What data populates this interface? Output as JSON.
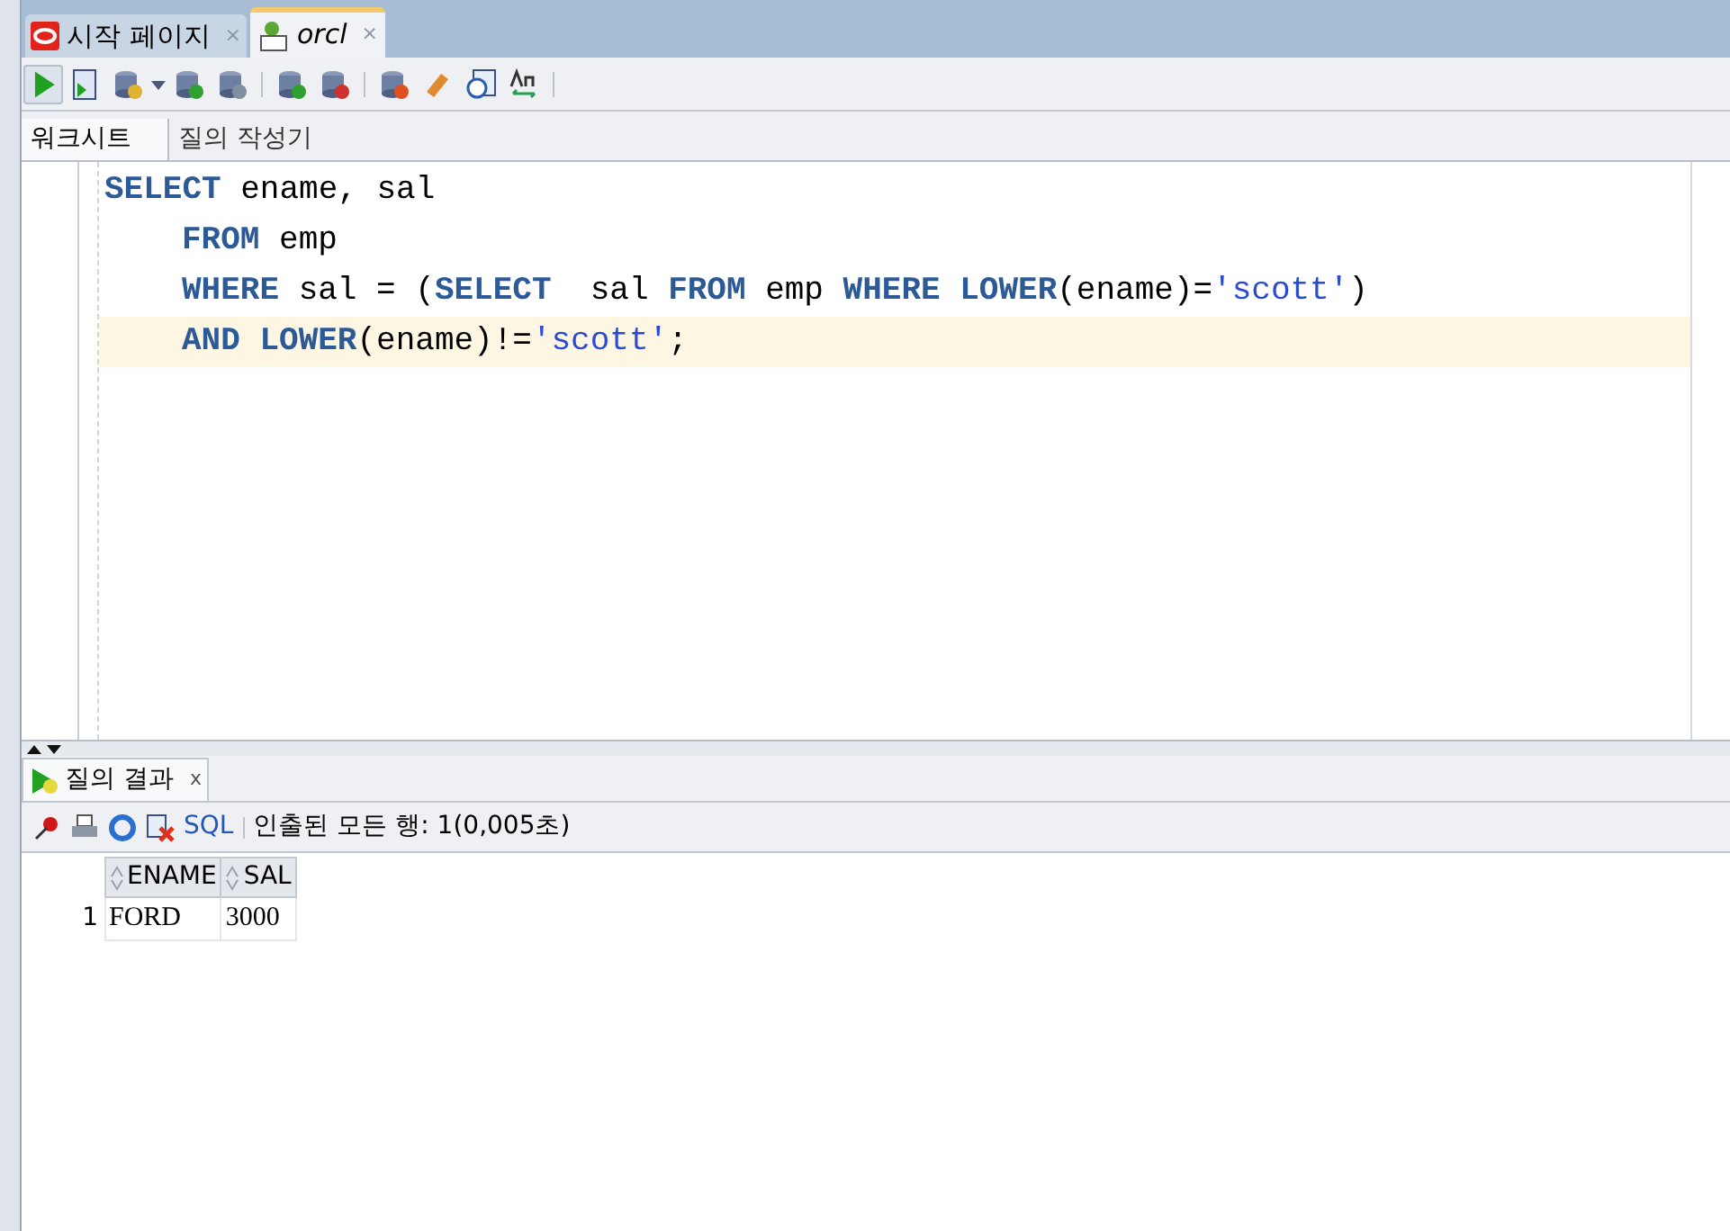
{
  "tabs": [
    {
      "label": "시작 페이지",
      "selected": false,
      "kind": "start",
      "close": "×"
    },
    {
      "label": "orcl",
      "selected": true,
      "kind": "sql",
      "close": "×"
    }
  ],
  "subtabs": [
    {
      "label": "워크시트",
      "selected": true
    },
    {
      "label": "질의 작성기",
      "selected": false
    }
  ],
  "editor": {
    "lines": [
      {
        "current": false,
        "indent": false,
        "tokens": [
          {
            "kind": "keyword",
            "text": "SELECT"
          },
          {
            "kind": "plain",
            "text": " ename, sal"
          }
        ]
      },
      {
        "current": false,
        "indent": true,
        "tokens": [
          {
            "kind": "keyword",
            "text": "FROM"
          },
          {
            "kind": "plain",
            "text": " emp"
          }
        ]
      },
      {
        "current": false,
        "indent": true,
        "tokens": [
          {
            "kind": "keyword",
            "text": "WHERE"
          },
          {
            "kind": "plain",
            "text": " sal = ("
          },
          {
            "kind": "keyword",
            "text": "SELECT"
          },
          {
            "kind": "plain",
            "text": "  sal "
          },
          {
            "kind": "keyword",
            "text": "FROM"
          },
          {
            "kind": "plain",
            "text": " emp "
          },
          {
            "kind": "keyword",
            "text": "WHERE "
          },
          {
            "kind": "keyword",
            "text": "LOWER"
          },
          {
            "kind": "plain",
            "text": "(ename)="
          },
          {
            "kind": "string",
            "text": "'scott'"
          },
          {
            "kind": "plain",
            "text": ")"
          }
        ]
      },
      {
        "current": true,
        "indent": true,
        "tokens": [
          {
            "kind": "keyword",
            "text": "AND "
          },
          {
            "kind": "keyword",
            "text": "LOWER"
          },
          {
            "kind": "plain",
            "text": "(ename)!="
          },
          {
            "kind": "string",
            "text": "'scott'"
          },
          {
            "kind": "plain",
            "text": ";"
          }
        ]
      }
    ]
  },
  "results": {
    "tab": {
      "label": "질의 결과",
      "close": "x",
      "selected": true
    },
    "sql_link": "SQL",
    "status": "인출된 모든 행: 1(0,005초)",
    "columns": [
      "ENAME",
      "SAL"
    ],
    "rows": [
      {
        "number": "1",
        "cells": [
          "FORD",
          "3000"
        ]
      }
    ]
  }
}
